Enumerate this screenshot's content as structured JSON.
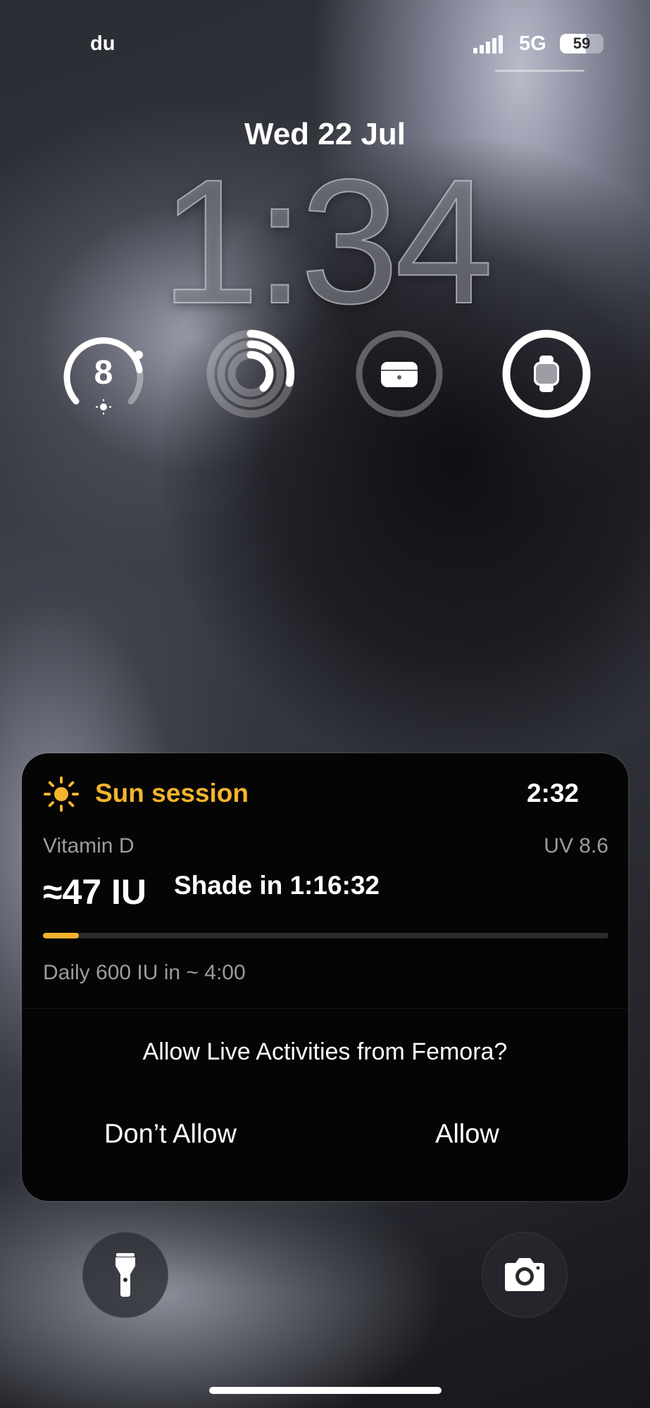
{
  "status_bar": {
    "carrier": "du",
    "network": "5G",
    "battery_percent": 59,
    "battery_label": "59"
  },
  "lock_screen": {
    "date": "Wed 22 Jul",
    "time": "1:34"
  },
  "widgets": [
    {
      "name": "uv-index-gauge",
      "value_label": "8",
      "icon": "sun-icon",
      "level": 0.8
    },
    {
      "name": "activity-rings",
      "icon": "activity-rings-icon"
    },
    {
      "name": "airpods-battery",
      "icon": "airpods-case-icon",
      "level": 0.0
    },
    {
      "name": "watch-battery",
      "icon": "watch-icon",
      "level": 1.0
    }
  ],
  "live_activity": {
    "icon": "sun-icon",
    "title": "Sun session",
    "elapsed": "2:32",
    "vitamin_label": "Vitamin D",
    "uv_label": "UV 8.6",
    "iu_value": "≈47 IU",
    "shade_text": "Shade in 1:16:32",
    "progress": 0.063,
    "daily_text": "Daily 600 IU in ~ 4:00",
    "accent_color": "#f5b42e"
  },
  "permission_prompt": {
    "question": "Allow Live Activities from Femora?",
    "deny_label": "Don’t Allow",
    "allow_label": "Allow"
  },
  "bottom_controls": {
    "left": "flashlight-icon",
    "right": "camera-icon"
  }
}
